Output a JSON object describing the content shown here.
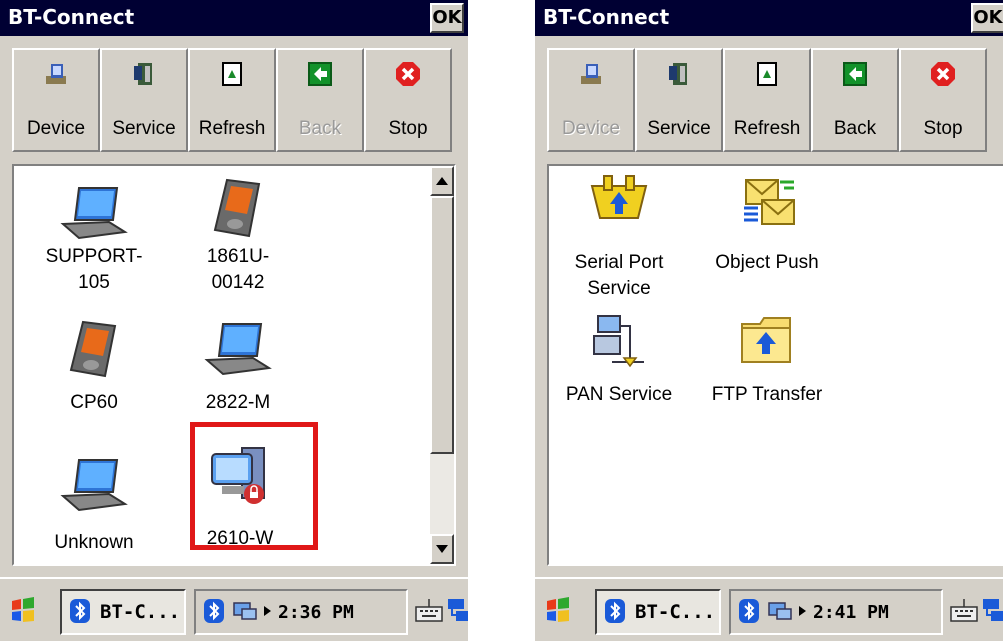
{
  "left": {
    "title": "BT-Connect",
    "ok_label": "OK",
    "toolbar": [
      {
        "label": "Device",
        "enabled": true,
        "icon": "device-icon"
      },
      {
        "label": "Service",
        "enabled": true,
        "icon": "service-icon"
      },
      {
        "label": "Refresh",
        "enabled": true,
        "icon": "refresh-icon"
      },
      {
        "label": "Back",
        "enabled": false,
        "icon": "back-arrow-icon"
      },
      {
        "label": "Stop",
        "enabled": true,
        "icon": "stop-icon"
      }
    ],
    "items": [
      {
        "label": "SUPPORT-\n105",
        "icon": "laptop-icon"
      },
      {
        "label": "1861U-\n00142",
        "icon": "handheld-icon"
      },
      {
        "label": "CP60",
        "icon": "handheld-icon"
      },
      {
        "label": "2822-M",
        "icon": "laptop-icon"
      },
      {
        "label": "Unknown",
        "icon": "laptop-icon"
      },
      {
        "label": "2610-W",
        "icon": "secure-computer-icon"
      }
    ],
    "taskbar": {
      "task_label": "BT-C...",
      "clock": "2:36 PM"
    }
  },
  "right": {
    "title": "BT-Connect",
    "ok_label": "OK",
    "toolbar": [
      {
        "label": "Device",
        "enabled": false,
        "icon": "device-icon"
      },
      {
        "label": "Service",
        "enabled": true,
        "icon": "service-icon"
      },
      {
        "label": "Refresh",
        "enabled": true,
        "icon": "refresh-icon"
      },
      {
        "label": "Back",
        "enabled": true,
        "icon": "back-arrow-icon"
      },
      {
        "label": "Stop",
        "enabled": true,
        "icon": "stop-icon"
      }
    ],
    "items": [
      {
        "label": "Serial Port\nService",
        "icon": "serial-port-icon"
      },
      {
        "label": "Object Push",
        "icon": "object-push-icon"
      },
      {
        "label": "PAN Service",
        "icon": "pan-network-icon"
      },
      {
        "label": "FTP Transfer",
        "icon": "ftp-folder-icon"
      }
    ],
    "taskbar": {
      "task_label": "BT-C...",
      "clock": "2:41 PM"
    }
  },
  "colors": {
    "titlebar": "#000033",
    "highlight": "#e01818",
    "window": "#d4d0c8"
  }
}
